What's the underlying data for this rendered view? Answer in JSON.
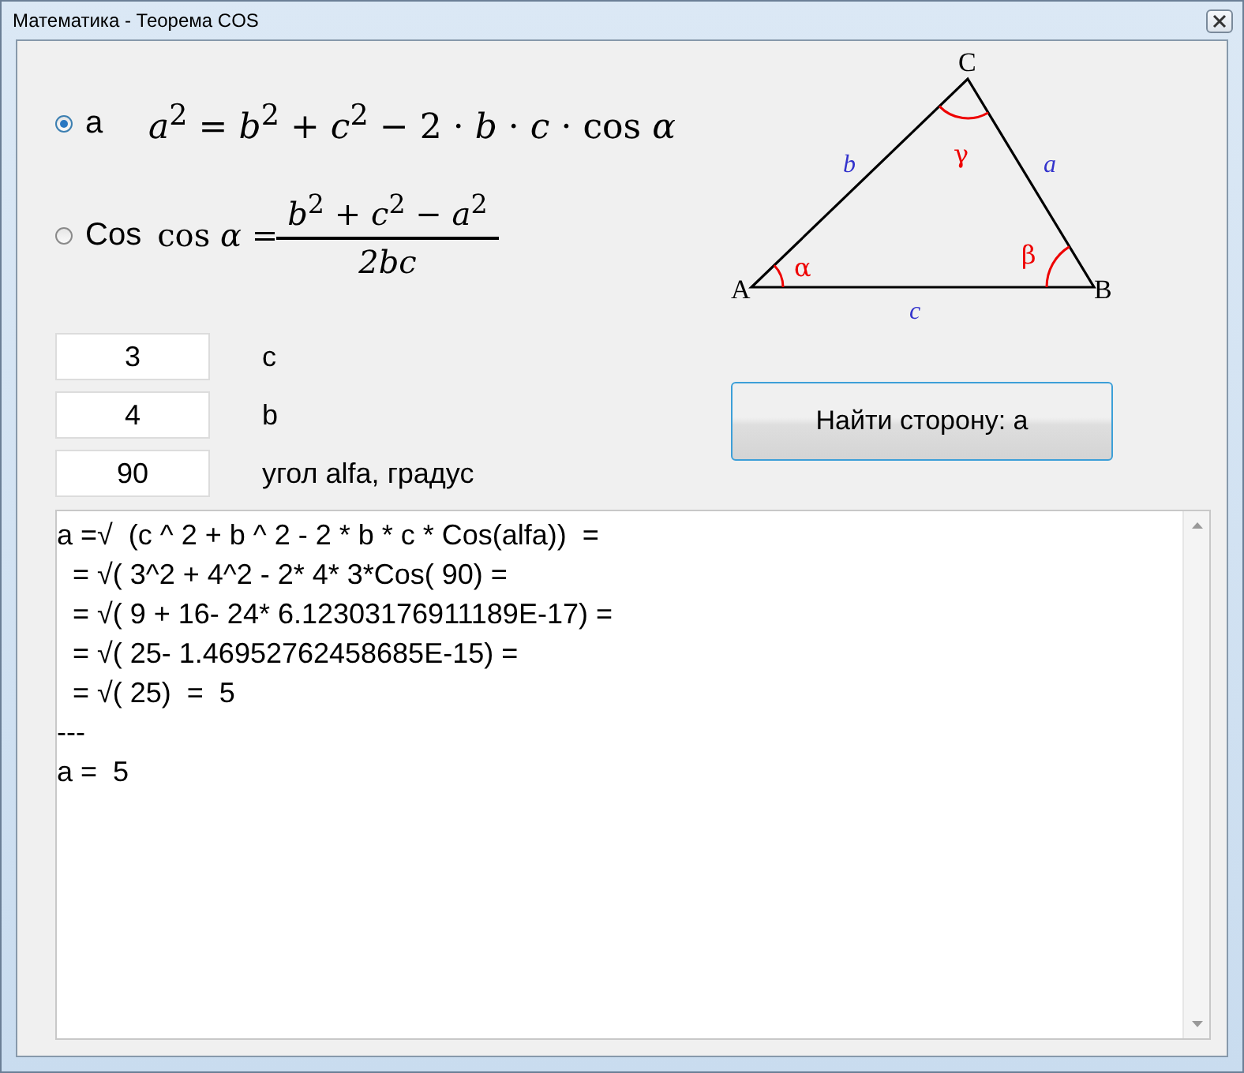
{
  "window": {
    "title": "Математика - Теорема COS"
  },
  "modes": [
    {
      "label": "a",
      "selected": true,
      "kind": "equation",
      "formula": "*a*$^{2}$ = *b*$^{2}$ + *c*$^{2}$ − 2 · *b* · *c* · cos *α*"
    },
    {
      "label": "Cos",
      "selected": false,
      "kind": "fraction",
      "lhs": "cos *α* =",
      "numerator": "*b*$^{2}$ + *c*$^{2}$ − *a*$^{2}$",
      "denominator": "2bc"
    }
  ],
  "triangle": {
    "vertices": [
      "A",
      "B",
      "C"
    ],
    "sides": [
      "a",
      "b",
      "c"
    ],
    "angles": [
      "α",
      "β",
      "γ"
    ]
  },
  "inputs": [
    {
      "value": "3",
      "label": "c"
    },
    {
      "value": "4",
      "label": "b"
    },
    {
      "value": "90",
      "label": "угол alfa, градус"
    }
  ],
  "button": {
    "label": "Найти сторону: a"
  },
  "output": {
    "lines": [
      "a =√  (c ^ 2 + b ^ 2 - 2 * b * c * Cos(alfa))  =",
      "  = √( 3^2 + 4^2 - 2* 4* 3*Cos( 90) =",
      "  = √( 9 + 16- 24* 6.12303176911189E-17) =",
      "  = √( 25- 1.46952762458685E-15) =",
      "  = √( 25)  =  5",
      "---",
      "a =  5"
    ]
  }
}
